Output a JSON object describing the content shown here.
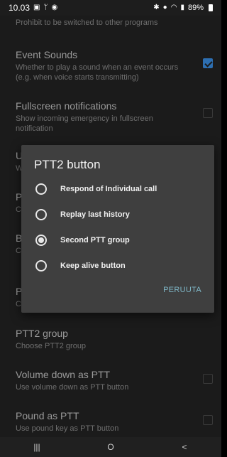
{
  "status_bar": {
    "time": "10.03",
    "battery": "89%"
  },
  "settings": {
    "top_partial_sub": "Prohibit to be switched to other programs",
    "items": [
      {
        "title": "Event Sounds",
        "subtitle": "Whether to play a sound when an event occurs (e.g. when voice starts transmitting)",
        "checked": true
      },
      {
        "title": "Fullscreen notifications",
        "subtitle": "Show incoming emergency in fullscreen notification",
        "checked": false
      },
      {
        "title": "U",
        "subtitle": "W"
      },
      {
        "title": "P",
        "subtitle": "C"
      },
      {
        "title": "B",
        "subtitle": "C h"
      },
      {
        "title": "P",
        "subtitle": "C"
      },
      {
        "title": "PTT2 group",
        "subtitle": "Choose PTT2 group"
      },
      {
        "title": "Volume down as PTT",
        "subtitle": "Use volume down as PTT button",
        "checked": false
      },
      {
        "title": "Pound as PTT",
        "subtitle": "Use pound key as PTT button",
        "checked": false
      }
    ]
  },
  "dialog": {
    "title": "PTT2 button",
    "options": [
      {
        "label": "Respond of Individual call",
        "selected": false
      },
      {
        "label": "Replay last history",
        "selected": false
      },
      {
        "label": "Second PTT group",
        "selected": true
      },
      {
        "label": "Keep alive button",
        "selected": false
      }
    ],
    "cancel_label": "PERUUTA"
  },
  "navbar": {
    "recent_icon": "|||",
    "home_icon": "O",
    "back_icon": "<"
  },
  "colors": {
    "accent_checkbox": "#2d6fb2",
    "dialog_button": "#7fb7c7",
    "dialog_bg": "#3f3f3f"
  }
}
